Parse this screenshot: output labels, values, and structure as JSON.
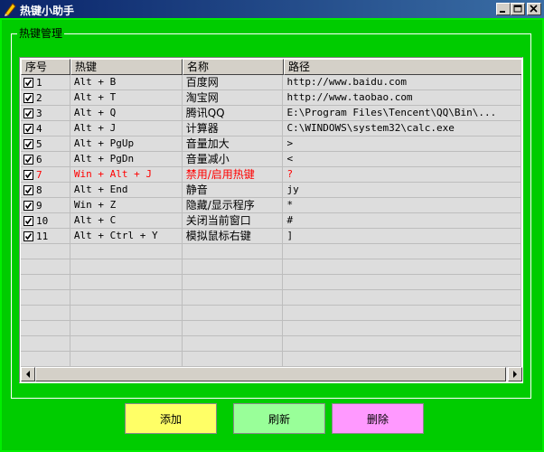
{
  "window": {
    "title": "热键小助手",
    "icon": "pencil-icon",
    "controls": [
      "minimize-icon",
      "maximize-icon",
      "close-icon"
    ]
  },
  "group": {
    "label": "热键管理"
  },
  "table": {
    "columns": [
      "序号",
      "热键",
      "名称",
      "路径"
    ],
    "rows": [
      {
        "no": "1",
        "checked": true,
        "hotkey": "Alt + B",
        "name": "百度网",
        "path": "http://www.baidu.com"
      },
      {
        "no": "2",
        "checked": true,
        "hotkey": "Alt + T",
        "name": "淘宝网",
        "path": "http://www.taobao.com"
      },
      {
        "no": "3",
        "checked": true,
        "hotkey": "Alt + Q",
        "name": "腾讯QQ",
        "path": "E:\\Program Files\\Tencent\\QQ\\Bin\\..."
      },
      {
        "no": "4",
        "checked": true,
        "hotkey": "Alt + J",
        "name": "计算器",
        "path": "C:\\WINDOWS\\system32\\calc.exe"
      },
      {
        "no": "5",
        "checked": true,
        "hotkey": "Alt + PgUp",
        "name": "音量加大",
        "path": ">"
      },
      {
        "no": "6",
        "checked": true,
        "hotkey": "Alt + PgDn",
        "name": "音量减小",
        "path": "<"
      },
      {
        "no": "7",
        "checked": true,
        "hotkey": "Win + Alt + J",
        "name": "禁用/启用热键",
        "path": "?",
        "highlight": true
      },
      {
        "no": "8",
        "checked": true,
        "hotkey": "Alt + End",
        "name": "静音",
        "path": "jy"
      },
      {
        "no": "9",
        "checked": true,
        "hotkey": "Win + Z",
        "name": "隐藏/显示程序",
        "path": "*"
      },
      {
        "no": "10",
        "checked": true,
        "hotkey": "Alt + C",
        "name": "关闭当前窗口",
        "path": "#"
      },
      {
        "no": "11",
        "checked": true,
        "hotkey": "Alt + Ctrl + Y",
        "name": "模拟鼠标右键",
        "path": "]"
      }
    ],
    "highlight_color": "#ff0000"
  },
  "buttons": {
    "add": {
      "label": "添加",
      "color": "#ffff66"
    },
    "refresh": {
      "label": "刷新",
      "color": "#99ff99"
    },
    "delete": {
      "label": "删除",
      "color": "#ff99ff"
    }
  },
  "colors": {
    "background": "#00cc00",
    "titlebar": "#0a246a"
  }
}
